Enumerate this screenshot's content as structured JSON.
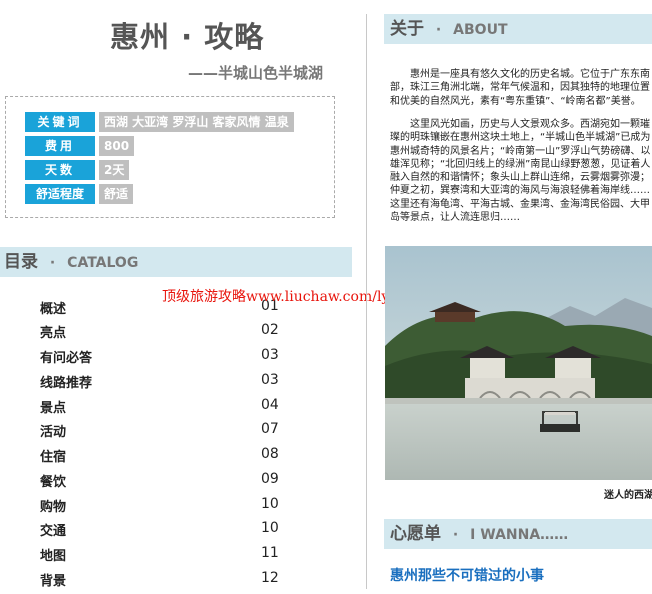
{
  "title": "惠州 · 攻略",
  "subtitle": "——半城山色半城湖",
  "info": [
    {
      "label": "关键词",
      "value": "西湖 大亚湾 罗浮山 客家风情 温泉"
    },
    {
      "label": "费用",
      "value": "800"
    },
    {
      "label": "天数",
      "value": "2天"
    },
    {
      "label": "舒适程度",
      "value": "舒适"
    }
  ],
  "catalog": {
    "title_cn": "目录",
    "title_sep": "·",
    "title_en": "CATALOG",
    "items": [
      {
        "name": "概述",
        "page": "01"
      },
      {
        "name": "亮点",
        "page": "02"
      },
      {
        "name": "有问必答",
        "page": "03"
      },
      {
        "name": "线路推荐",
        "page": "03"
      },
      {
        "name": "景点",
        "page": "04"
      },
      {
        "name": "活动",
        "page": "07"
      },
      {
        "name": "住宿",
        "page": "08"
      },
      {
        "name": "餐饮",
        "page": "09"
      },
      {
        "name": "购物",
        "page": "10"
      },
      {
        "name": "交通",
        "page": "10"
      },
      {
        "name": "地图",
        "page": "11"
      },
      {
        "name": "背景",
        "page": "12"
      }
    ]
  },
  "watermark": "顶级旅游攻略www.liuchaw.com/lyyou/ailvyou",
  "about": {
    "title_cn": "关于",
    "title_sep": "·",
    "title_en": "ABOUT",
    "para1": "惠州是一座具有悠久文化的历史名城。它位于广东东南部，珠江三角洲北端，常年气候温和，因其独特的地理位置和优美的自然风光，素有“粤东重镇”、“岭南名都”美誉。",
    "para2": "这里风光如画，历史与人文景观众多。西湖宛如一颗璀璨的明珠镶嵌在惠州这块土地上，“半城山色半城湖”已成为惠州城奇特的风景名片；“岭南第一山”罗浮山气势磅礴、以雄浑见称；“北回归线上的绿洲”南昆山绿野葱葱，见证着人融入自然的和谐情怀；象头山上群山连绵，云雾烟雾弥漫；仲夏之初，巽寮湾和大亚湾的海风与海浪轻佛着海岸线……这里还有海龟湾、平海古城、金果湾、金海湾民俗园、大甲岛等景点，让人流连思归……",
    "caption": "迷人的西湖"
  },
  "wish": {
    "title_cn": "心愿单",
    "title_sep": "·",
    "title_en": "I WANNA……",
    "subtitle": "惠州那些不可错过的小事"
  },
  "colors": {
    "label_blue": "#1aa3d9",
    "value_gray": "#bfbfbf",
    "section_bg": "#d3e8ef",
    "watermark_red": "#e8140c",
    "link_blue": "#1a6fbf"
  }
}
